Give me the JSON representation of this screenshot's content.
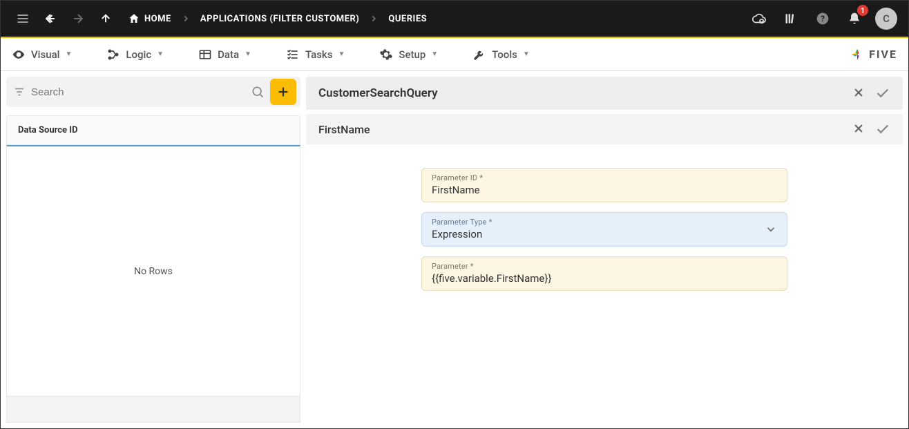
{
  "topbar": {
    "breadcrumbs": [
      {
        "label": "HOME"
      },
      {
        "label": "APPLICATIONS (FILTER CUSTOMER)"
      },
      {
        "label": "QUERIES"
      }
    ],
    "notifications_count": "1",
    "avatar_letter": "C"
  },
  "tabs": {
    "visual": "Visual",
    "logic": "Logic",
    "data": "Data",
    "tasks": "Tasks",
    "setup": "Setup",
    "tools": "Tools",
    "brand": "FIVE"
  },
  "left": {
    "search_placeholder": "Search",
    "column_header": "Data Source ID",
    "empty_text": "No Rows"
  },
  "right": {
    "query_title": "CustomerSearchQuery",
    "param_title": "FirstName",
    "fields": {
      "param_id_label": "Parameter ID *",
      "param_id_value": "FirstName",
      "param_type_label": "Parameter Type *",
      "param_type_value": "Expression",
      "param_value_label": "Parameter *",
      "param_value_value": "{{five.variable.FirstName}}"
    }
  }
}
